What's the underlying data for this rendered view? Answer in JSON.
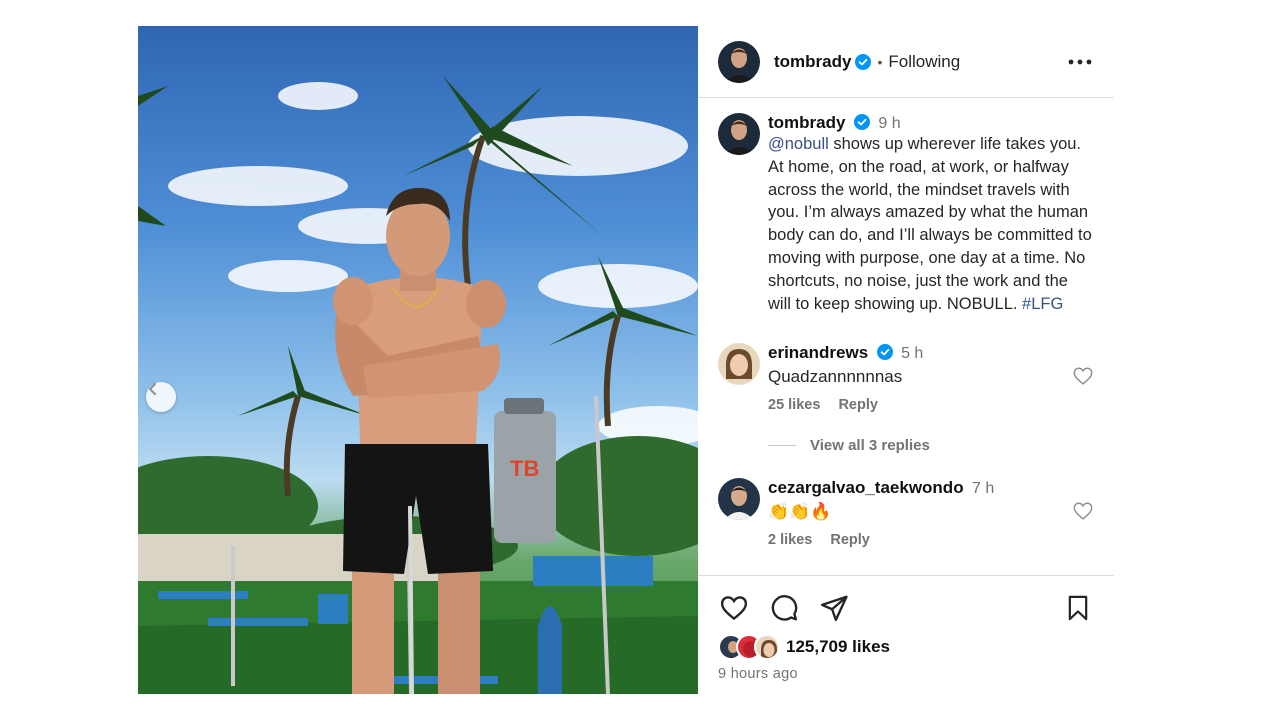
{
  "post": {
    "username": "tombrady",
    "following_label": "Following",
    "separator": "•",
    "time_short": "9 h",
    "caption_mention": "@nobull",
    "caption_body": " shows up wherever life takes you. At home, on the road, at work, or halfway across the world, the mindset travels with you. I’m always amazed by what the human body can do, and I’ll always be committed to moving with purpose, one day at a time. No shortcuts, no noise, just the work and the will to keep showing up. NOBULL. ",
    "caption_hashtag": "#LFG",
    "likes_label": "125,709 likes",
    "posted_ago": "9 hours ago"
  },
  "comments": [
    {
      "username": "erinandrews",
      "time": "5 h",
      "text": "Quadzannnnnnas",
      "likes": "25 likes",
      "reply_label": "Reply",
      "view_replies": "View all 3 replies"
    },
    {
      "username": "cezargalvao_taekwondo",
      "time": "7 h",
      "text": "👏👏🔥",
      "likes": "2 likes",
      "reply_label": "Reply"
    }
  ],
  "colors": {
    "verified": "#0095f6",
    "link": "#385185",
    "muted": "#737373",
    "border": "#dbdbdb"
  },
  "icons": {
    "nav": "chevron-left-icon",
    "more": "more-horizontal-icon",
    "like": "heart-icon",
    "comment": "comment-icon",
    "share": "send-icon",
    "save": "bookmark-icon"
  }
}
